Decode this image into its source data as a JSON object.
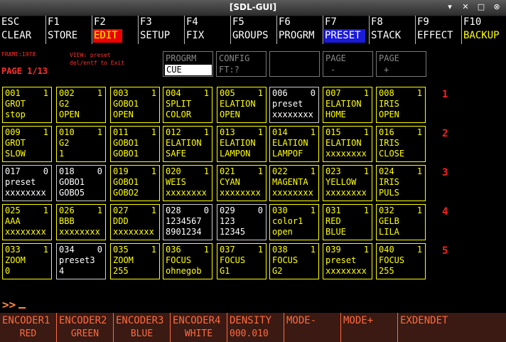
{
  "window": {
    "title": "[SDL-GUI]",
    "controls": [
      "▾",
      "✕",
      "□",
      "⊗"
    ]
  },
  "fkeys": [
    {
      "key": "ESC",
      "label": "CLEAR",
      "style": "plain"
    },
    {
      "key": "F1",
      "label": "STORE",
      "style": "plain"
    },
    {
      "key": "F2",
      "label": "EDIT",
      "style": "red"
    },
    {
      "key": "F3",
      "label": "SETUP",
      "style": "plain"
    },
    {
      "key": "F4",
      "label": "FIX",
      "style": "plain"
    },
    {
      "key": "F5",
      "label": "GROUPS",
      "style": "plain"
    },
    {
      "key": "F6",
      "label": "PROGRM",
      "style": "plain"
    },
    {
      "key": "F7",
      "label": "PRESET",
      "style": "blue"
    },
    {
      "key": "F8",
      "label": "STACK",
      "style": "plain"
    },
    {
      "key": "F9",
      "label": "EFFECT",
      "style": "plain"
    },
    {
      "key": "F10",
      "label": "BACKUP",
      "style": "yellow"
    }
  ],
  "info": {
    "frame": "FRAME:1978",
    "view": "VIEW: preset",
    "hint": "del/entf to Exit",
    "page": "PAGE 1/13"
  },
  "header_boxes": [
    {
      "line1": "PROGRM",
      "line2": "CUE",
      "input": true
    },
    {
      "line1": "CONFIG",
      "line2": "FT:?",
      "input": false
    },
    {
      "line1": "",
      "line2": "",
      "input": false
    },
    {
      "line1": "PAGE",
      "line2": "-",
      "input": false
    },
    {
      "line1": "PAGE",
      "line2": "+",
      "input": false
    }
  ],
  "row_numbers": [
    "1",
    "2",
    "3",
    "4",
    "5"
  ],
  "cells": [
    [
      {
        "num": "001",
        "flag": "1",
        "l1": "GROT",
        "l2": "stop"
      },
      {
        "num": "002",
        "flag": "1",
        "l1": "G2",
        "l2": "OPEN"
      },
      {
        "num": "003",
        "flag": "1",
        "l1": "GOBO1",
        "l2": "OPEN"
      },
      {
        "num": "004",
        "flag": "1",
        "l1": "SPLIT",
        "l2": "COLOR"
      },
      {
        "num": "005",
        "flag": "1",
        "l1": "ELATION",
        "l2": "OPEN"
      },
      {
        "num": "006",
        "flag": "0",
        "l1": "preset",
        "l2": "xxxxxxxx"
      },
      {
        "num": "007",
        "flag": "1",
        "l1": "ELATION",
        "l2": "HOME"
      },
      {
        "num": "008",
        "flag": "1",
        "l1": "IRIS",
        "l2": "OPEN"
      }
    ],
    [
      {
        "num": "009",
        "flag": "1",
        "l1": "GROT",
        "l2": "SLOW"
      },
      {
        "num": "010",
        "flag": "1",
        "l1": "G2",
        "l2": "1"
      },
      {
        "num": "011",
        "flag": "1",
        "l1": "GOBO1",
        "l2": "GOBO1"
      },
      {
        "num": "012",
        "flag": "1",
        "l1": "ELATION",
        "l2": "SAFE"
      },
      {
        "num": "013",
        "flag": "1",
        "l1": "ELATION",
        "l2": "LAMPON"
      },
      {
        "num": "014",
        "flag": "1",
        "l1": "ELATION",
        "l2": "LAMPOF"
      },
      {
        "num": "015",
        "flag": "1",
        "l1": "ELATION",
        "l2": "xxxxxxxx"
      },
      {
        "num": "016",
        "flag": "1",
        "l1": "IRIS",
        "l2": "CLOSE"
      }
    ],
    [
      {
        "num": "017",
        "flag": "0",
        "l1": "preset",
        "l2": "xxxxxxxx"
      },
      {
        "num": "018",
        "flag": "0",
        "l1": "GOBO1",
        "l2": "GOBO5"
      },
      {
        "num": "019",
        "flag": "1",
        "l1": "GOBO1",
        "l2": "GOBO2"
      },
      {
        "num": "020",
        "flag": "1",
        "l1": "WEIS",
        "l2": "xxxxxxxx"
      },
      {
        "num": "021",
        "flag": "1",
        "l1": "CYAN",
        "l2": "xxxxxxxx"
      },
      {
        "num": "022",
        "flag": "1",
        "l1": "MAGENTA",
        "l2": "xxxxxxxx"
      },
      {
        "num": "023",
        "flag": "1",
        "l1": "YELLOW",
        "l2": "xxxxxxxx"
      },
      {
        "num": "024",
        "flag": "1",
        "l1": "IRIS",
        "l2": "PULS"
      }
    ],
    [
      {
        "num": "025",
        "flag": "1",
        "l1": "AAA",
        "l2": "xxxxxxxx"
      },
      {
        "num": "026",
        "flag": "1",
        "l1": "BBB",
        "l2": "xxxxxxxx"
      },
      {
        "num": "027",
        "flag": "1",
        "l1": "DDD",
        "l2": "xxxxxxxx"
      },
      {
        "num": "028",
        "flag": "0",
        "l1": "1234567",
        "l2": "8901234"
      },
      {
        "num": "029",
        "flag": "0",
        "l1": "123",
        "l2": "12345"
      },
      {
        "num": "030",
        "flag": "1",
        "l1": "color1",
        "l2": "open"
      },
      {
        "num": "031",
        "flag": "1",
        "l1": "RED",
        "l2": "BLUE"
      },
      {
        "num": "032",
        "flag": "1",
        "l1": "GELB",
        "l2": "LILA"
      }
    ],
    [
      {
        "num": "033",
        "flag": "1",
        "l1": "ZOOM",
        "l2": "0"
      },
      {
        "num": "034",
        "flag": "0",
        "l1": "preset3",
        "l2": "4"
      },
      {
        "num": "035",
        "flag": "1",
        "l1": "ZOOM",
        "l2": "255"
      },
      {
        "num": "036",
        "flag": "1",
        "l1": "FOCUS",
        "l2": "ohnegob"
      },
      {
        "num": "037",
        "flag": "1",
        "l1": "FOCUS",
        "l2": "G1"
      },
      {
        "num": "038",
        "flag": "1",
        "l1": "FOCUS",
        "l2": "G2"
      },
      {
        "num": "039",
        "flag": "1",
        "l1": "preset",
        "l2": "xxxxxxxx"
      },
      {
        "num": "040",
        "flag": "1",
        "l1": "FOCUS",
        "l2": "255"
      }
    ]
  ],
  "command": {
    "prompt": ">>"
  },
  "encoders": [
    {
      "label": "ENCODER1",
      "value": "RED"
    },
    {
      "label": "ENCODER2",
      "value": "GREEN"
    },
    {
      "label": "ENCODER3",
      "value": "BLUE"
    },
    {
      "label": "ENCODER4",
      "value": "WHITE"
    },
    {
      "label": "DENSITY",
      "value": "000.010"
    },
    {
      "label": "MODE-",
      "value": ""
    },
    {
      "label": "MODE+",
      "value": ""
    },
    {
      "label": "EXDENDET",
      "value": ""
    }
  ],
  "colors": {
    "active": "#ffff00",
    "inactive": "#ffffff",
    "accent": "#ff2020",
    "encoder": "#ff6a40"
  }
}
